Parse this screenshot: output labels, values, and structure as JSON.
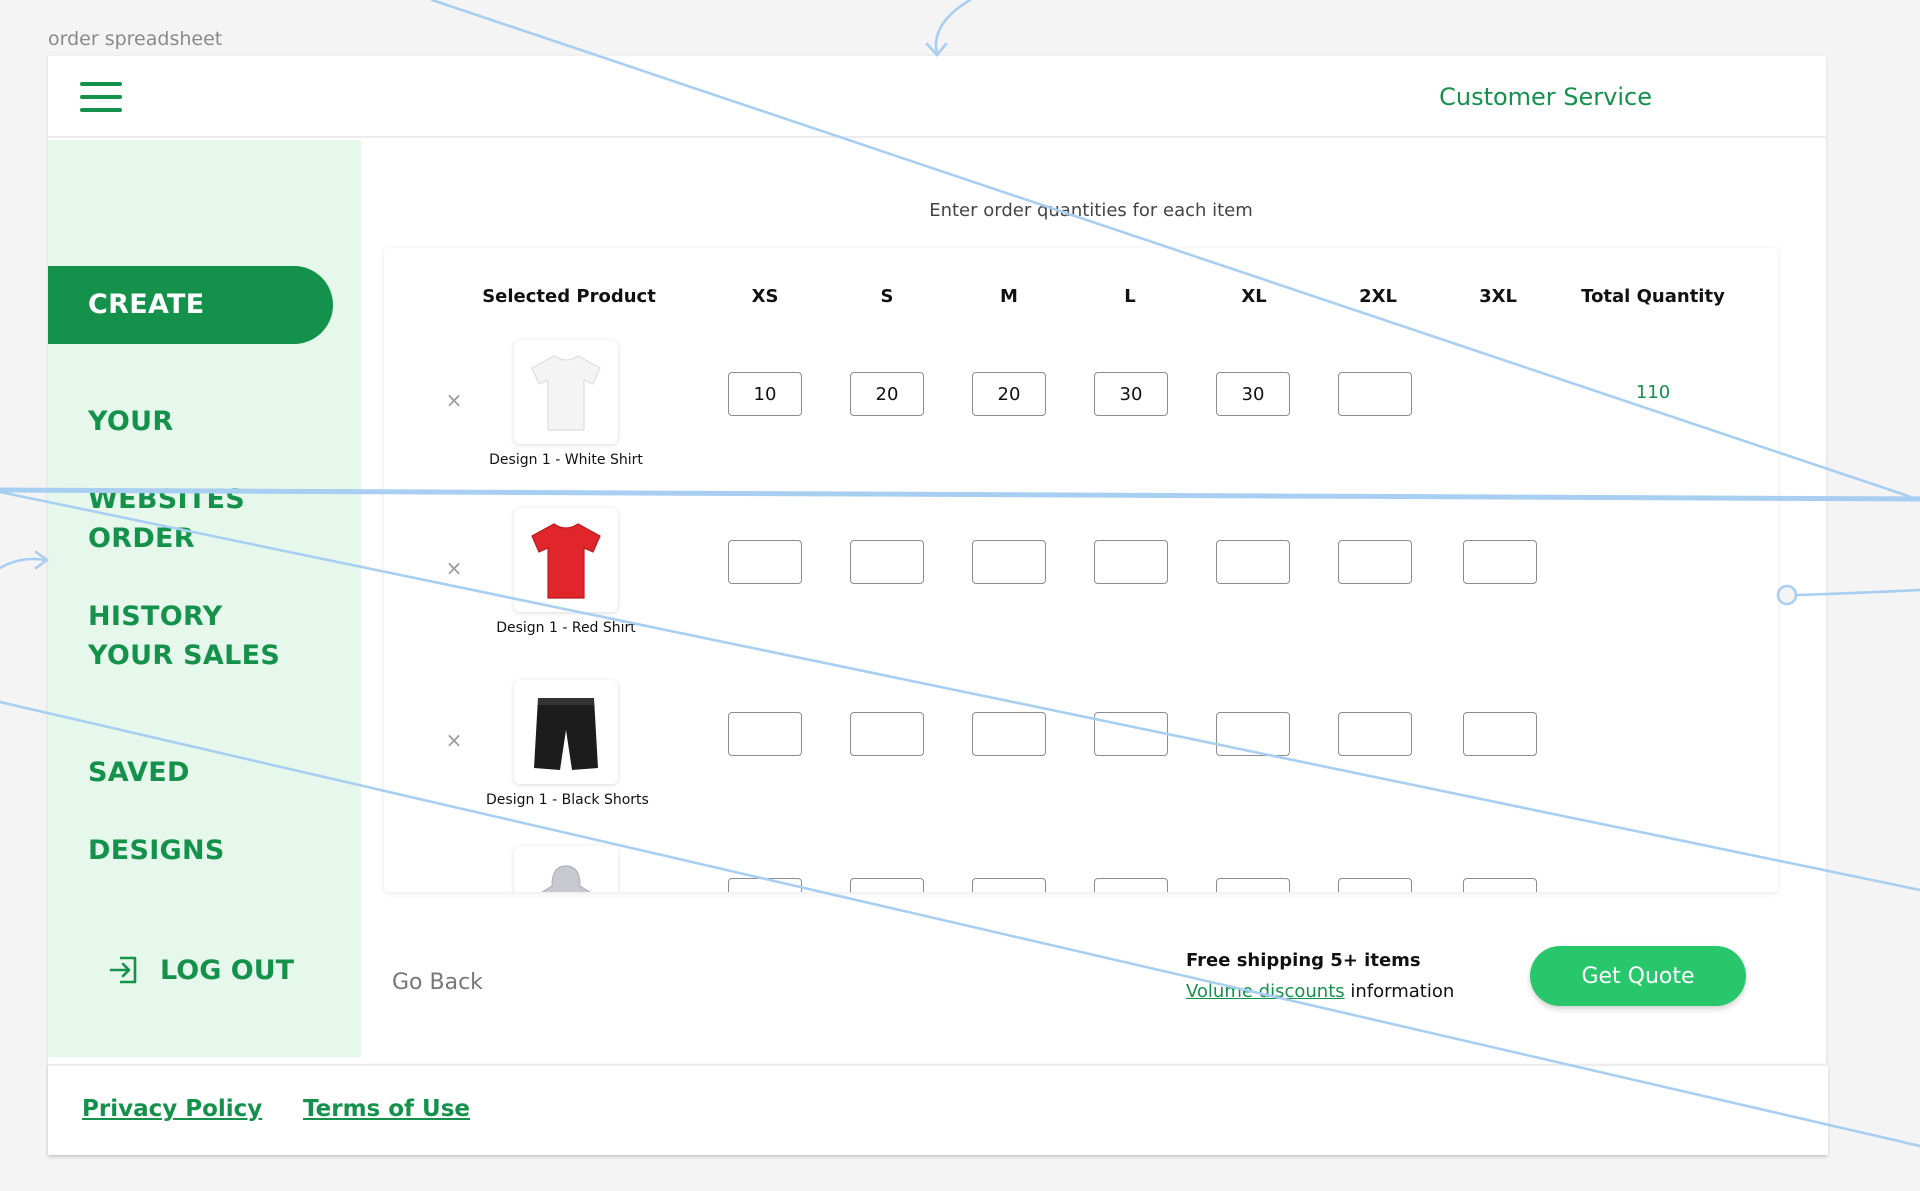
{
  "frame_label": "order spreadsheet",
  "header": {
    "menu_icon": "hamburger-menu-icon",
    "customer_service": "Customer Service"
  },
  "sidebar": {
    "items": [
      {
        "label": "CREATE",
        "active": true
      },
      {
        "label": "YOUR WEBSITES",
        "active": false
      },
      {
        "label": "ORDER HISTORY",
        "active": false
      },
      {
        "label": "YOUR SALES",
        "active": false
      },
      {
        "label": "SAVED DESIGNS",
        "active": false
      }
    ],
    "logout_label": "LOG OUT",
    "logout_icon": "logout-icon"
  },
  "main": {
    "instructions": "Enter order quantities for each item",
    "table": {
      "headers": [
        "Selected Product",
        "XS",
        "S",
        "M",
        "L",
        "XL",
        "2XL",
        "3XL",
        "Total Quantity"
      ],
      "rows": [
        {
          "name": "Design 1 - White Shirt",
          "product": "white-tshirt",
          "color": "#f4f4f4",
          "quantities": [
            "10",
            "20",
            "20",
            "30",
            "30",
            ""
          ],
          "total": "110"
        },
        {
          "name": "Design 1 - Red Shirt",
          "product": "red-tshirt",
          "color": "#e0262b",
          "quantities": [
            "",
            "",
            "",
            "",
            "",
            "",
            ""
          ],
          "total": ""
        },
        {
          "name": "Design 1 - Black Shorts",
          "product": "black-shorts",
          "color": "#1c1c1c",
          "quantities": [
            "",
            "",
            "",
            "",
            "",
            "",
            ""
          ],
          "total": ""
        },
        {
          "name": "",
          "product": "gray-hoodie",
          "color": "#c9c9d1",
          "quantities": [
            "",
            "",
            "",
            "",
            "",
            "",
            ""
          ],
          "total": ""
        }
      ]
    }
  },
  "actions": {
    "go_back": "Go Back",
    "shipping_text": "Free shipping 5+ items",
    "volume_link": "Volume discounts",
    "volume_suffix": " information",
    "quote_button": "Get Quote"
  },
  "footer": {
    "privacy": "Privacy Policy",
    "terms": "Terms of Use"
  },
  "colors": {
    "brand_green": "#14914b",
    "sidebar_bg": "#e6f8ec",
    "button_green": "#28c76b",
    "annotation_blue": "#a8cff2"
  }
}
